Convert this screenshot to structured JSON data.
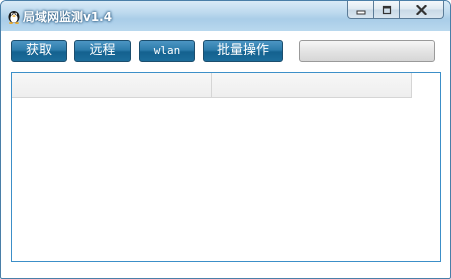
{
  "window": {
    "title": "局域网监测v1.4",
    "title_icon": "app-mascot-icon"
  },
  "titlebar_controls": {
    "minimize_icon": "minimize-icon",
    "maximize_icon": "maximize-icon",
    "close_icon": "close-icon"
  },
  "toolbar": {
    "fetch_label": "获取",
    "remote_label": "远程",
    "wlan_label": "wlan",
    "batch_label": "批量操作",
    "status_value": ""
  },
  "listview": {
    "columns": [
      "",
      ""
    ],
    "rows": []
  },
  "colors": {
    "button_blue": "#2d7cab",
    "list_border": "#3c8fc8",
    "titlebar": "#bcd9ee"
  }
}
